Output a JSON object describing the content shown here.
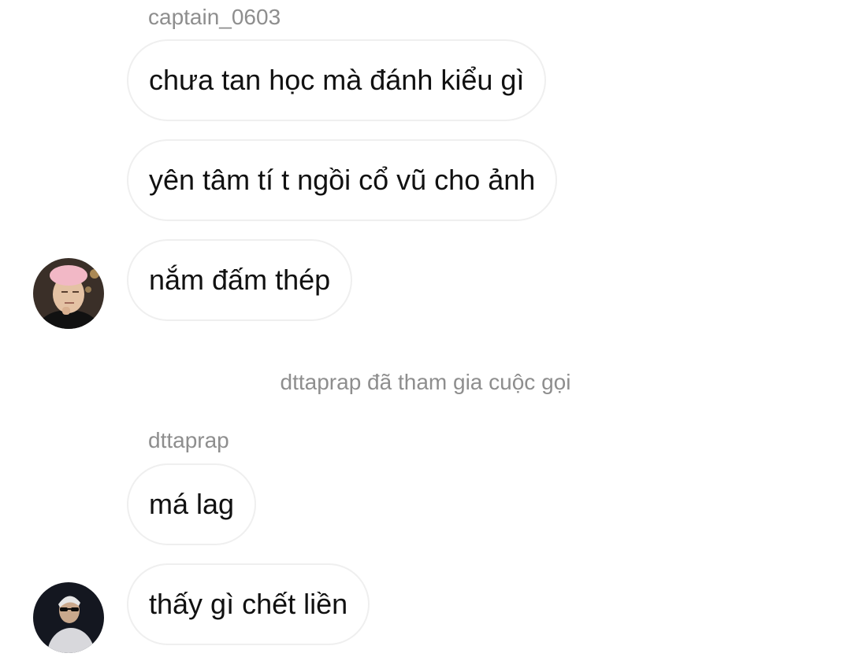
{
  "thread": {
    "group1": {
      "sender": "captain_0603",
      "messages": [
        "chưa tan học mà đánh kiểu gì",
        "yên tâm tí t ngồi cổ vũ cho ảnh",
        "nắm đấm thép"
      ],
      "avatar_icon": "user-avatar-photo"
    },
    "system_event": "dttaprap đã tham gia cuộc gọi",
    "group2": {
      "sender": "dttaprap",
      "messages": [
        "má lag",
        "thấy gì chết liền"
      ],
      "avatar_icon": "user-avatar-photo"
    }
  },
  "colors": {
    "background": "#ffffff",
    "bubble_border": "#efefef",
    "meta_text": "#8e8e8e",
    "message_text": "#111111"
  }
}
